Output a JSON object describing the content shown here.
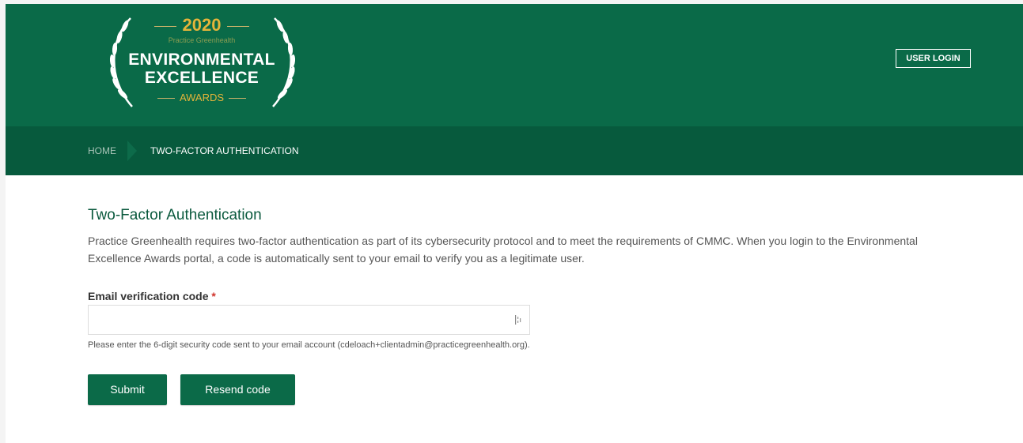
{
  "header": {
    "logo": {
      "year": "2020",
      "sub": "Practice Greenhealth",
      "line1": "ENVIRONMENTAL",
      "line2": "EXCELLENCE",
      "awards": "AWARDS"
    },
    "user_login_label": "USER LOGIN"
  },
  "breadcrumb": {
    "home": "HOME",
    "current": "TWO-FACTOR AUTHENTICATION"
  },
  "main": {
    "title": "Two-Factor Authentication",
    "intro": "Practice Greenhealth requires two-factor authentication as part of its cybersecurity protocol and to meet the requirements of CMMC. When you login to the Environmental Excellence Awards portal, a code is automatically sent to your email to verify you as a legitimate user.",
    "field_label": "Email verification code",
    "required_mark": "*",
    "code_value": "",
    "help_text": "Please enter the 6-digit security code sent to your email account (cdeloach+clientadmin@practicegreenhealth.org).",
    "submit_label": "Submit",
    "resend_label": "Resend code"
  },
  "icons": {
    "laurel": "laurel-wreath-icon",
    "input": "password-manager-icon"
  },
  "colors": {
    "header": "#0a6a48",
    "breadcrumb_bar": "#075a3d",
    "button": "#0b6a48",
    "gold": "#e3b43a",
    "required": "#d0342c"
  }
}
